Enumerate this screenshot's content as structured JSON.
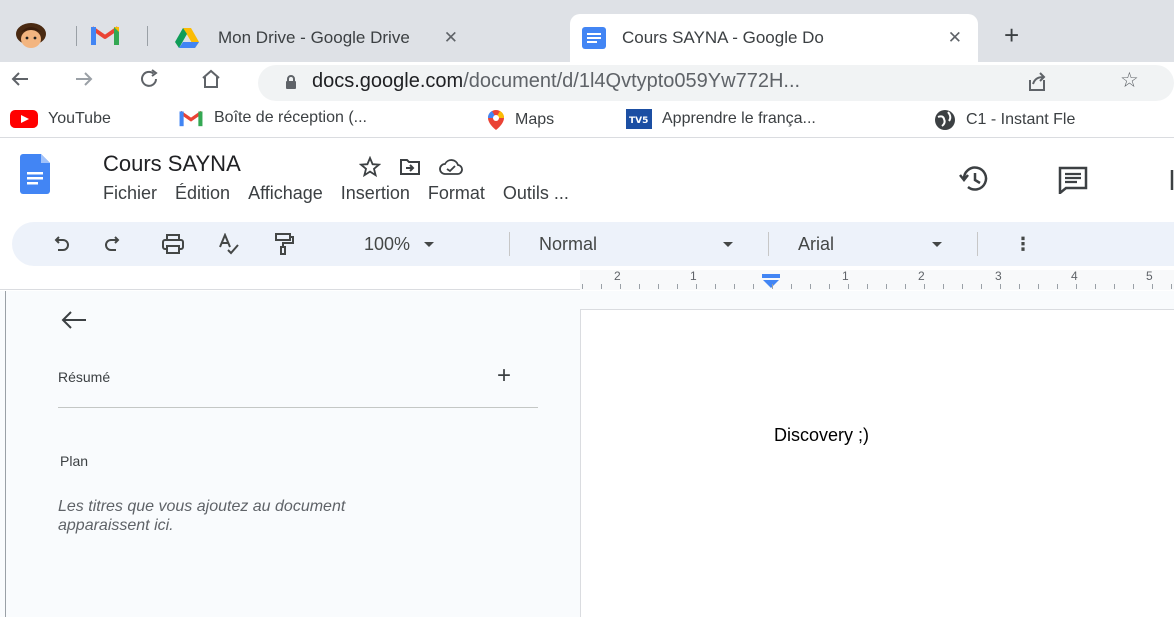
{
  "browser": {
    "tabs": [
      {
        "title": "Mon Drive - Google Drive",
        "close": "✕"
      },
      {
        "title": "Cours SAYNA - Google Do",
        "close": "✕"
      }
    ],
    "new_tab": "+",
    "address": {
      "host": "docs.google.com",
      "path": "/document/d/1l4Qvtypto059Yw772H..."
    },
    "bookmarks": [
      {
        "label": "YouTube",
        "icon": "youtube-icon"
      },
      {
        "label": "Boîte de réception (...",
        "icon": "gmail-icon"
      },
      {
        "label": "Maps",
        "icon": "maps-icon"
      },
      {
        "label": "Apprendre le frança...",
        "icon": "tv5-icon"
      },
      {
        "label": "C1 - Instant Fle",
        "icon": "globe-icon"
      }
    ]
  },
  "docs": {
    "title": "Cours SAYNA",
    "menu": [
      "Fichier",
      "Édition",
      "Affichage",
      "Insertion",
      "Format",
      "Outils ..."
    ],
    "toolbar": {
      "zoom": "100%",
      "style": "Normal",
      "font": "Arial",
      "more": "⋮"
    },
    "ruler_numbers": [
      "2",
      "1",
      "1",
      "2",
      "3",
      "4",
      "5"
    ],
    "outline": {
      "summary_label": "Résumé",
      "add": "+",
      "plan_label": "Plan",
      "plan_hint": "Les titres que vous ajoutez au document apparaissent ici."
    },
    "page_text": "Discovery ;)"
  },
  "colors": {
    "tabstrip": "#dee1e6",
    "docs_blue": "#4285f4",
    "toolbar_bg": "#edf2fa",
    "gmail_red": "#ea4335"
  }
}
